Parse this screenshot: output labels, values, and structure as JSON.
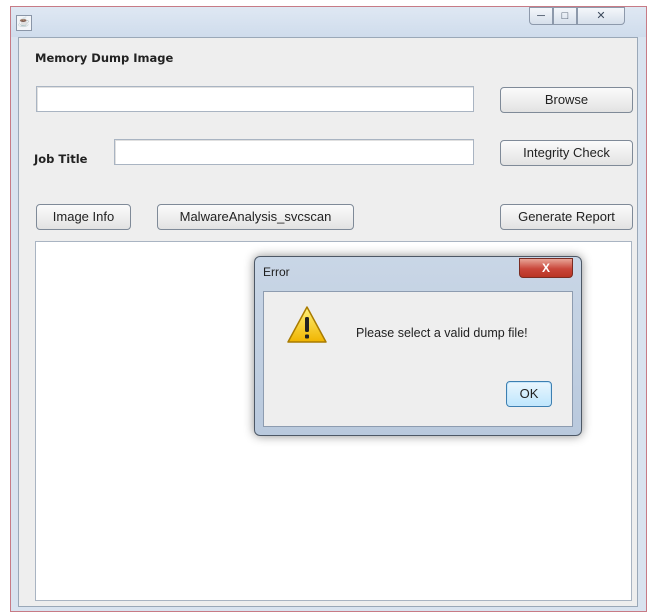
{
  "window": {
    "icon": "java-cup-icon",
    "controls": {
      "minimize": "minimize-icon",
      "maximize": "maximize-icon",
      "close": "close-icon"
    }
  },
  "form": {
    "memory_dump_label": "Memory Dump Image",
    "memory_dump_value": "",
    "browse_label": "Browse",
    "job_title_label": "Job Title",
    "job_title_value": "",
    "integrity_check_label": "Integrity Check",
    "image_info_label": "Image Info",
    "malware_analysis_label": "MalwareAnalysis_svcscan",
    "generate_report_label": "Generate Report",
    "output_text": ""
  },
  "dialog": {
    "title": "Error",
    "close_glyph": "X",
    "icon": "warning-icon",
    "message": "Please select a valid dump file!",
    "ok_label": "OK"
  },
  "colors": {
    "window_border": "#c77b86",
    "dialog_close": "#c9463a",
    "ok_focus": "#bee6fd",
    "warning": "#f5c400"
  }
}
